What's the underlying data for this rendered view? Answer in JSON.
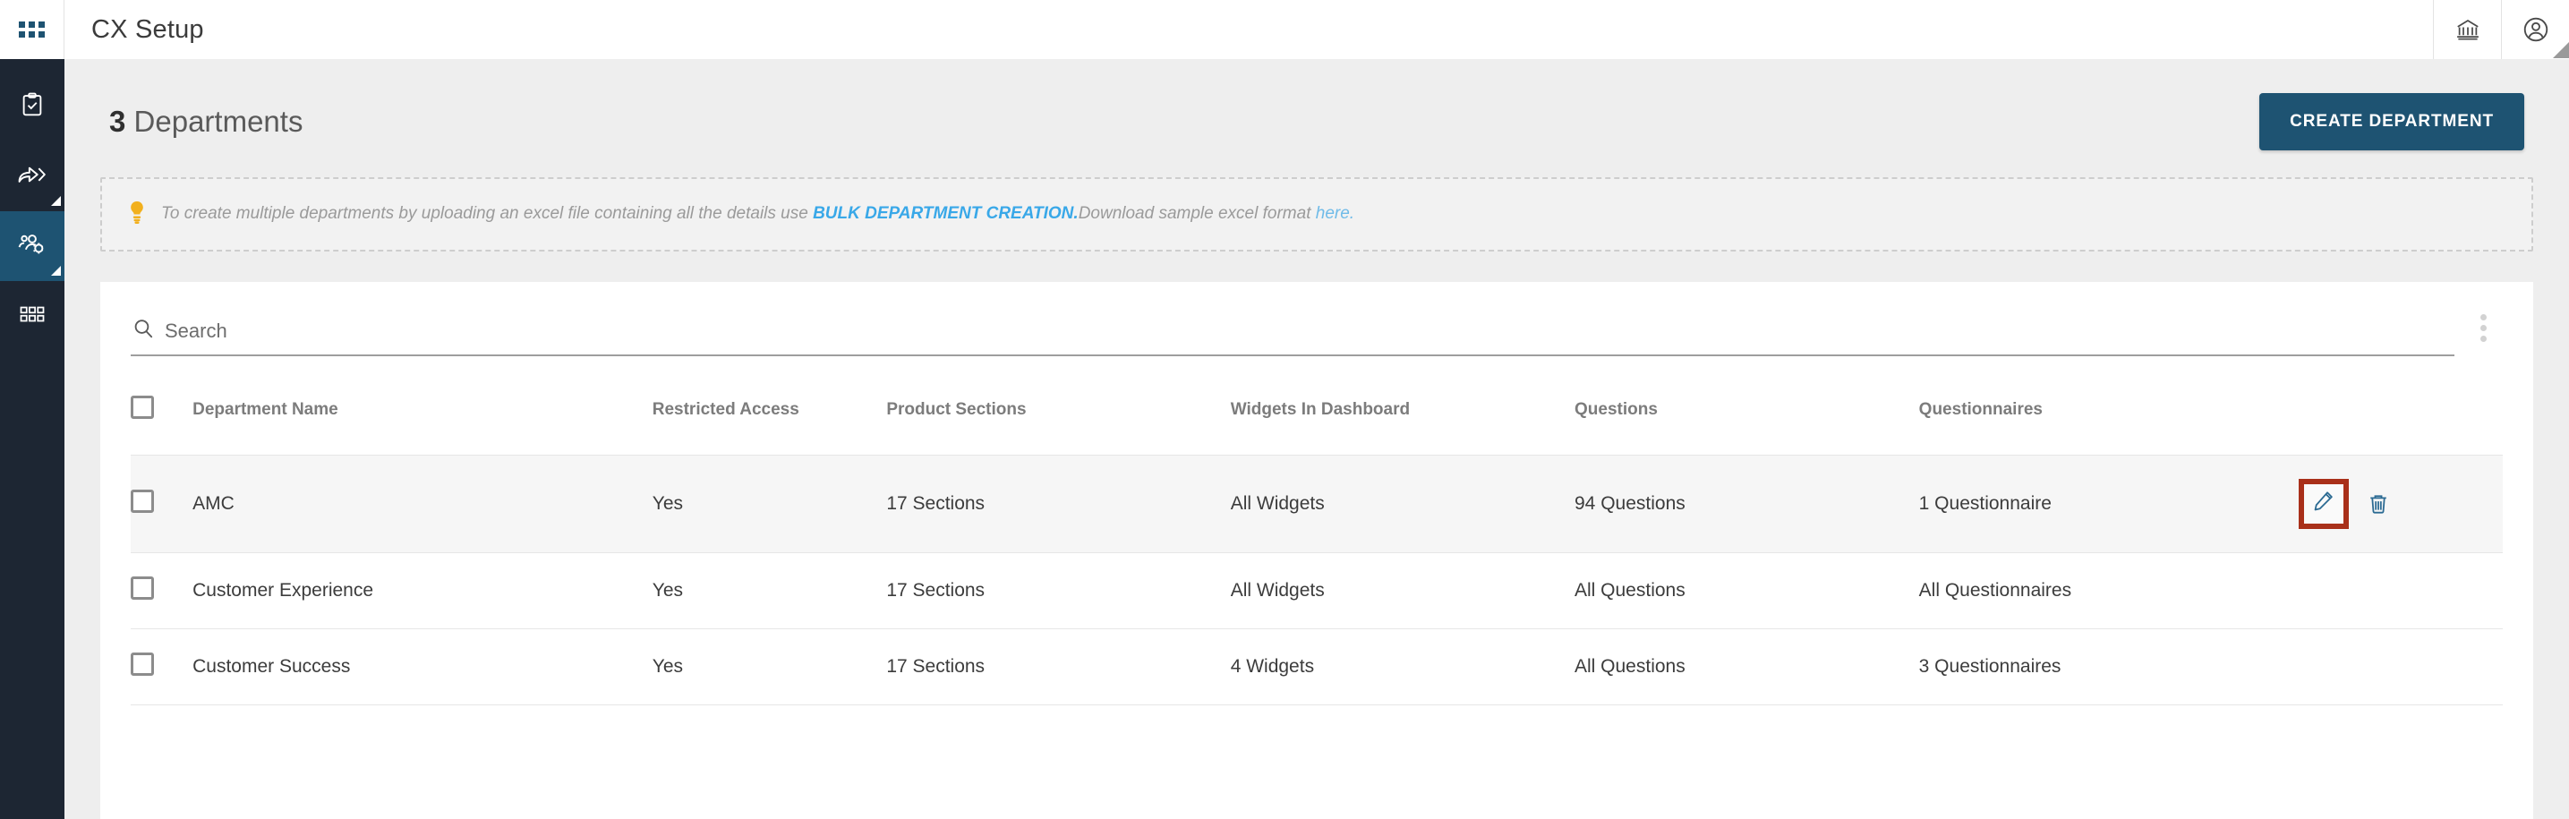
{
  "topbar": {
    "title": "CX Setup",
    "launcher_icon": "grid-apps-icon",
    "actions": [
      {
        "icon": "bank-institution-icon",
        "name": "organization-button"
      },
      {
        "icon": "user-account-icon",
        "name": "account-button"
      }
    ]
  },
  "sidebar": {
    "items": [
      {
        "icon": "clipboard-check-icon",
        "name": "sidebar-item-surveys",
        "active": false,
        "has_submenu": false
      },
      {
        "icon": "share-forward-arrow-icon",
        "name": "sidebar-item-distribution",
        "active": false,
        "has_submenu": true
      },
      {
        "icon": "users-settings-icon",
        "name": "sidebar-item-user-management",
        "active": true,
        "has_submenu": true
      },
      {
        "icon": "grid-modules-icon",
        "name": "sidebar-item-modules",
        "active": false,
        "has_submenu": false
      }
    ]
  },
  "page": {
    "count": "3",
    "title": "Departments",
    "create_button": "CREATE DEPARTMENT"
  },
  "banner": {
    "icon": "lightbulb-icon",
    "text_before": "To create multiple departments by uploading an excel file containing all the details use ",
    "bulk_link": "BULK DEPARTMENT CREATION.",
    "text_middle": "Download sample excel format ",
    "here_link": "here.",
    "accent_color": "#39a8e8"
  },
  "search": {
    "placeholder": "Search",
    "value": "",
    "icon": "search-icon",
    "menu_icon": "kebab-menu-icon"
  },
  "table": {
    "columns": [
      "Department Name",
      "Restricted Access",
      "Product Sections",
      "Widgets In Dashboard",
      "Questions",
      "Questionnaires"
    ],
    "rows": [
      {
        "name": "AMC",
        "restricted_access": "Yes",
        "product_sections": "17 Sections",
        "widgets": "All Widgets",
        "questions": "94 Questions",
        "questionnaires": "1 Questionnaire",
        "highlighted": true,
        "show_actions": true,
        "edit_icon": "pencil-edit-icon",
        "delete_icon": "trash-delete-icon"
      },
      {
        "name": "Customer Experience",
        "restricted_access": "Yes",
        "product_sections": "17 Sections",
        "widgets": "All Widgets",
        "questions": "All Questions",
        "questionnaires": "All Questionnaires",
        "highlighted": false,
        "show_actions": false
      },
      {
        "name": "Customer Success",
        "restricted_access": "Yes",
        "product_sections": "17 Sections",
        "widgets": "4 Widgets",
        "questions": "All Questions",
        "questionnaires": "3 Questionnaires",
        "highlighted": false,
        "show_actions": false
      }
    ]
  },
  "highlight": {
    "target": "edit-button-row-amc",
    "color": "#a9301a"
  }
}
